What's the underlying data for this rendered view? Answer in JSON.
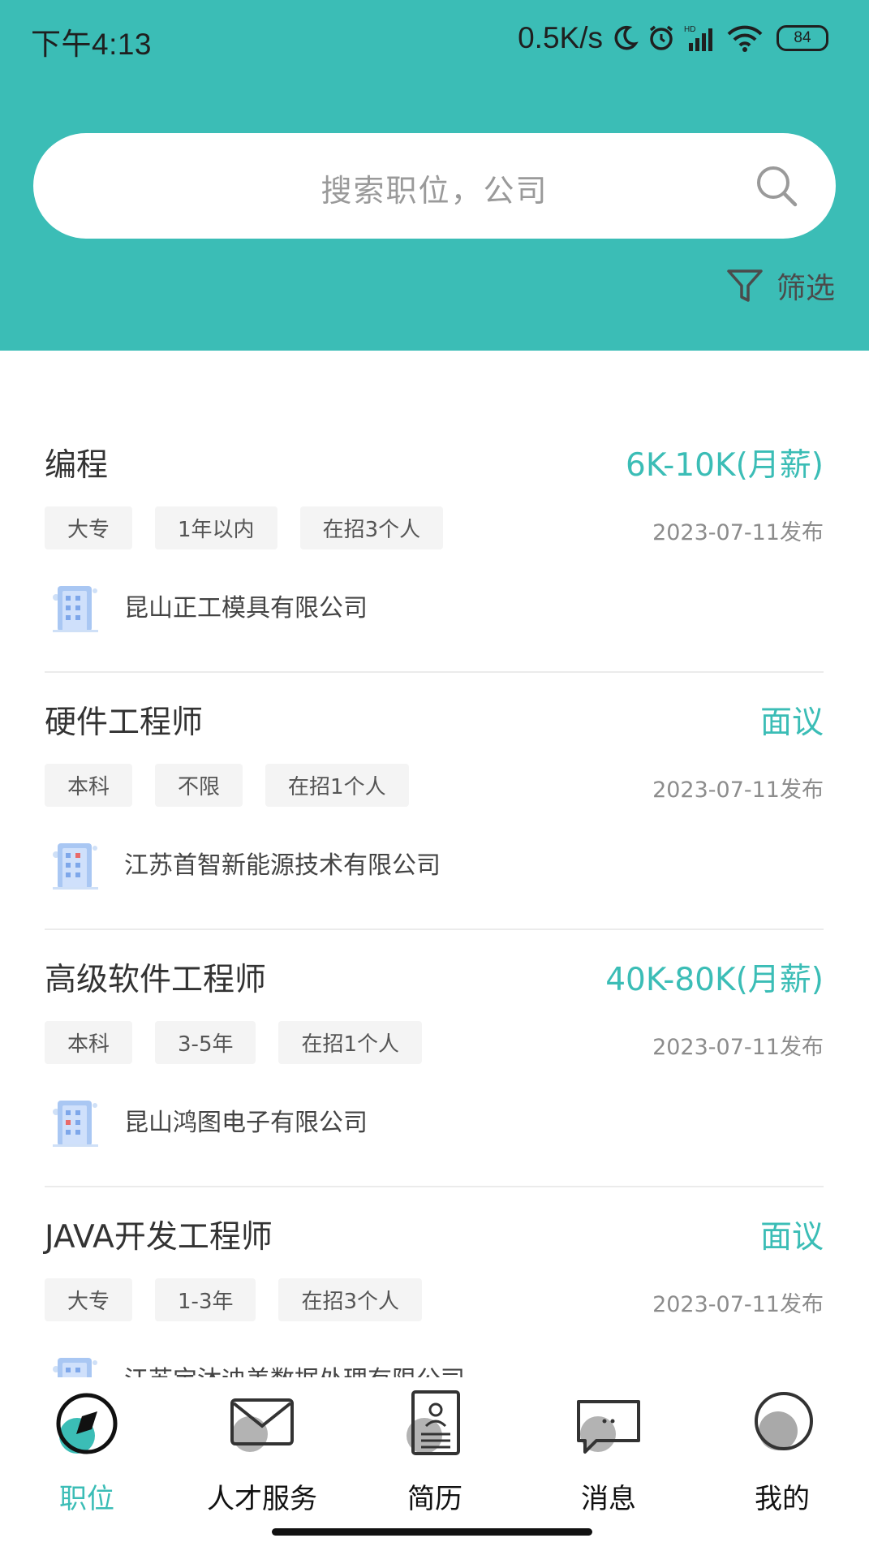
{
  "status_bar": {
    "time": "下午4:13",
    "speed": "0.5K/s",
    "battery": "84",
    "icons": [
      "moon-icon",
      "alarm-icon",
      "hd-signal-icon",
      "wifi-icon",
      "battery-icon"
    ]
  },
  "search": {
    "placeholder": "搜索职位，公司"
  },
  "filter": {
    "label": "筛选"
  },
  "jobs": [
    {
      "title": "编程",
      "salary": "6K-10K(月薪)",
      "tags": [
        "大专",
        "1年以内",
        "在招3个人"
      ],
      "date": "2023-07-11发布",
      "company": "昆山正工模具有限公司"
    },
    {
      "title": "硬件工程师",
      "salary": "面议",
      "tags": [
        "本科",
        "不限",
        "在招1个人"
      ],
      "date": "2023-07-11发布",
      "company": "江苏首智新能源技术有限公司"
    },
    {
      "title": "高级软件工程师",
      "salary": "40K-80K(月薪)",
      "tags": [
        "本科",
        "3-5年",
        "在招1个人"
      ],
      "date": "2023-07-11发布",
      "company": "昆山鸿图电子有限公司"
    },
    {
      "title": "JAVA开发工程师",
      "salary": "面议",
      "tags": [
        "大专",
        "1-3年",
        "在招3个人"
      ],
      "date": "2023-07-11发布",
      "company": "江苏宝沐迪美数据处理有限公司"
    }
  ],
  "tabbar": {
    "tabs": [
      {
        "label": "职位",
        "icon": "position-icon",
        "active": true
      },
      {
        "label": "人才服务",
        "icon": "mail-icon",
        "active": false
      },
      {
        "label": "简历",
        "icon": "resume-icon",
        "active": false
      },
      {
        "label": "消息",
        "icon": "message-icon",
        "active": false
      },
      {
        "label": "我的",
        "icon": "profile-icon",
        "active": false
      }
    ]
  },
  "colors": {
    "accent": "#3bbdb6",
    "tag_bg": "#f4f4f4",
    "divider": "#ebebeb"
  }
}
